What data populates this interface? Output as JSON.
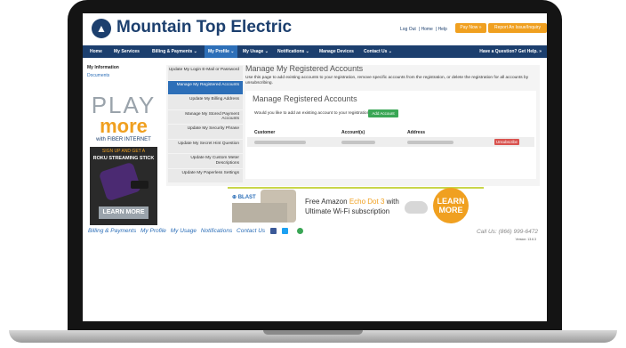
{
  "header": {
    "brand": "Mountain Top Electric",
    "top_links": [
      "Log Out",
      "Home",
      "Help"
    ],
    "pay_button": "Pay Now »",
    "report_button": "Report An Issue/Inquiry"
  },
  "nav": {
    "items": [
      "Home",
      "My Services",
      "Billing & Payments ⌄",
      "My Profile ⌄",
      "My Usage ⌄",
      "Notifications ⌄",
      "Manage Devices",
      "Contact Us ⌄"
    ],
    "help": "Have a Question? Get Help. »"
  },
  "sidebar": {
    "heading": "My Information",
    "link": "Documents"
  },
  "ad": {
    "play": "PLAY",
    "more": "more",
    "fiber": "with FIBER INTERNET",
    "sign_up": "SIGN UP AND GET A",
    "roku": "ROKU STREAMING STICK",
    "learn": "LEARN MORE"
  },
  "profile_menu": [
    "Update My Login E-Mail or Password",
    "Manage My Registered Accounts",
    "Update My Billing Address",
    "Manage My Stored Payment Accounts",
    "Update My Security Phrase",
    "Update My Secret Hint Question",
    "Update My Custom Meter Descriptions",
    "Update My Paperless Settings"
  ],
  "content": {
    "title": "Manage My Registered Accounts",
    "description": "Use this page to add existing accounts to your registration, remove specific accounts from the registration, or delete the registration for all accounts by unsubscribing.",
    "card_title": "Manage Registered Accounts",
    "question": "Would you like to add an existing account to your registration?",
    "add_button": "Add Account",
    "columns": [
      "Customer",
      "Account(s)",
      "Address"
    ],
    "unsubscribe": "Unsubscribe"
  },
  "banner": {
    "blast": "BLAST",
    "line1_pre": "Free Amazon ",
    "line1_hl": "Echo Dot 3",
    "line1_post": " with",
    "line2": "Ultimate Wi-Fi subscription",
    "learn1": "LEARN",
    "learn2": "MORE"
  },
  "footer": {
    "links": [
      "Billing & Payments",
      "My Profile",
      "My Usage",
      "Notifications",
      "Contact Us"
    ],
    "call": "Call Us: (866) 999-6472",
    "version": "Version: 13.6.3"
  },
  "colors": {
    "brand": "#1c3f6e",
    "accent": "#f0a020",
    "active": "#2d6fb8"
  }
}
